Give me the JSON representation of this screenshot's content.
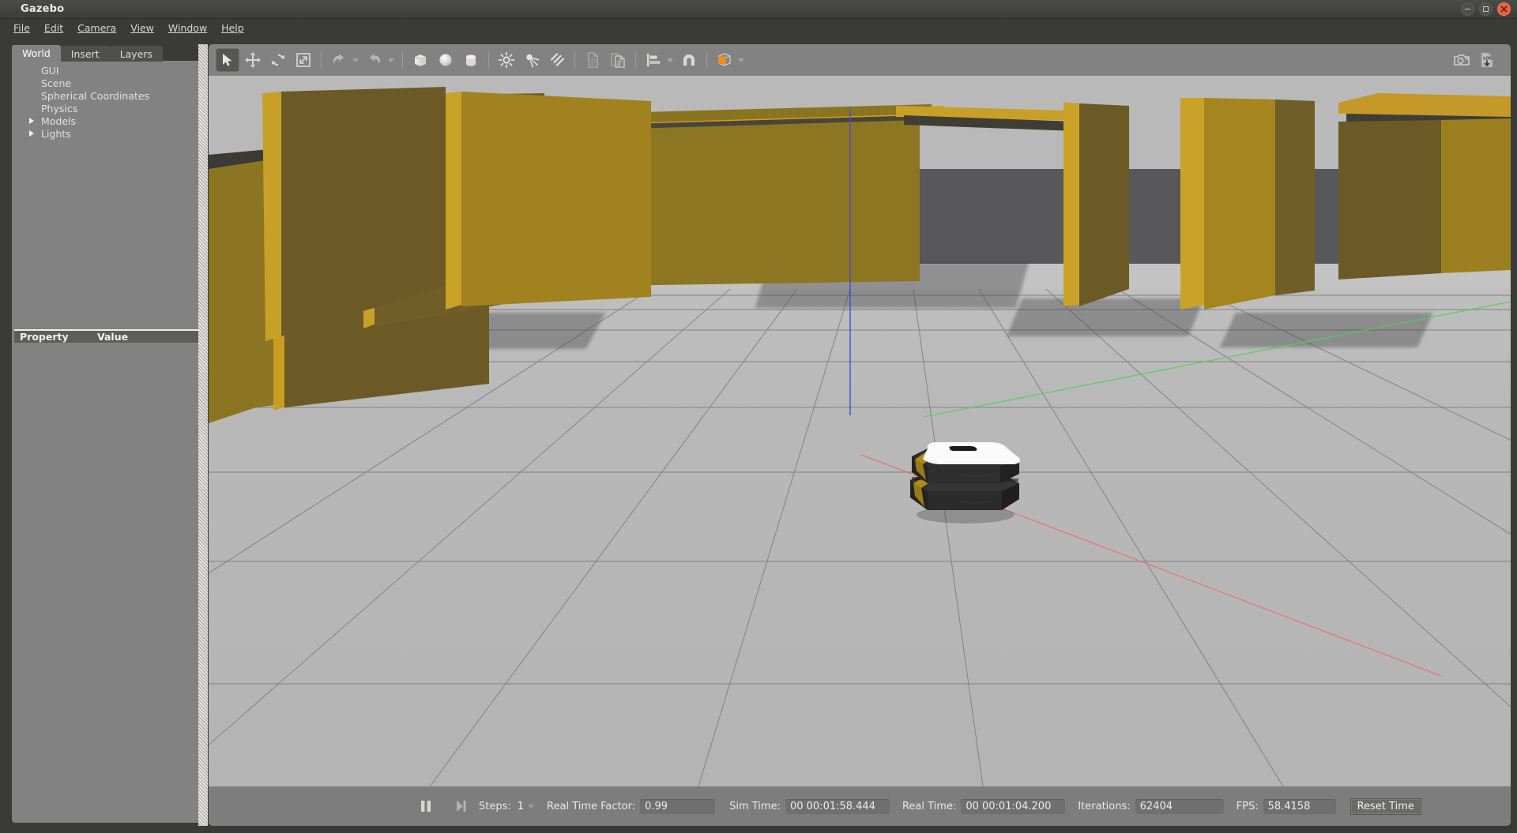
{
  "window": {
    "title": "Gazebo",
    "controls": [
      {
        "name": "minimize",
        "glyph": "–"
      },
      {
        "name": "maximize",
        "glyph": "□"
      },
      {
        "name": "close",
        "glyph": "×"
      }
    ]
  },
  "menubar": {
    "items": [
      {
        "label": "File",
        "mnemonic": "F"
      },
      {
        "label": "Edit",
        "mnemonic": "E"
      },
      {
        "label": "Camera",
        "mnemonic": "C"
      },
      {
        "label": "View",
        "mnemonic": "V"
      },
      {
        "label": "Window",
        "mnemonic": "W"
      },
      {
        "label": "Help",
        "mnemonic": "H"
      }
    ]
  },
  "left_panel": {
    "tabs": [
      {
        "label": "World",
        "active": true
      },
      {
        "label": "Insert",
        "active": false
      },
      {
        "label": "Layers",
        "active": false
      }
    ],
    "tree": [
      {
        "label": "GUI",
        "expandable": false
      },
      {
        "label": "Scene",
        "expandable": false
      },
      {
        "label": "Spherical Coordinates",
        "expandable": false
      },
      {
        "label": "Physics",
        "expandable": false
      },
      {
        "label": "Models",
        "expandable": true
      },
      {
        "label": "Lights",
        "expandable": true
      }
    ],
    "property_table": {
      "columns": [
        "Property",
        "Value"
      ],
      "rows": []
    }
  },
  "toolbar": {
    "groups": [
      {
        "name": "manipulation",
        "buttons": [
          {
            "name": "select-mode",
            "icon": "cursor-arrow-icon",
            "label": "Selection Mode",
            "active": true
          },
          {
            "name": "translate-mode",
            "icon": "move-arrows-icon",
            "label": "Translation Mode",
            "active": false
          },
          {
            "name": "rotate-mode",
            "icon": "rotate-arrows-icon",
            "label": "Rotation Mode",
            "active": false
          },
          {
            "name": "scale-mode",
            "icon": "scale-diagonal-icon",
            "label": "Scale Mode",
            "active": false
          }
        ]
      },
      {
        "name": "history",
        "buttons": [
          {
            "name": "undo",
            "icon": "undo-arrow-icon",
            "label": "Undo",
            "has_dropdown": true
          },
          {
            "name": "redo",
            "icon": "redo-arrow-icon",
            "label": "Redo",
            "has_dropdown": true
          }
        ]
      },
      {
        "name": "primitives",
        "buttons": [
          {
            "name": "insert-box",
            "icon": "box-icon",
            "label": "Box"
          },
          {
            "name": "insert-sphere",
            "icon": "sphere-icon",
            "label": "Sphere"
          },
          {
            "name": "insert-cylinder",
            "icon": "cylinder-icon",
            "label": "Cylinder"
          }
        ]
      },
      {
        "name": "lights",
        "buttons": [
          {
            "name": "insert-point-light",
            "icon": "point-light-icon",
            "label": "Point Light"
          },
          {
            "name": "insert-spot-light",
            "icon": "spot-light-icon",
            "label": "Spot Light"
          },
          {
            "name": "insert-directional-light",
            "icon": "directional-light-icon",
            "label": "Directional Light"
          }
        ]
      },
      {
        "name": "clipboard",
        "buttons": [
          {
            "name": "copy",
            "icon": "copy-icon",
            "label": "Copy"
          },
          {
            "name": "paste",
            "icon": "paste-icon",
            "label": "Paste"
          }
        ]
      },
      {
        "name": "align-snap",
        "buttons": [
          {
            "name": "align",
            "icon": "align-icon",
            "label": "Align",
            "has_dropdown": true
          },
          {
            "name": "snap",
            "icon": "magnet-snap-icon",
            "label": "Snap"
          }
        ]
      },
      {
        "name": "view-mode",
        "buttons": [
          {
            "name": "view-transparent",
            "icon": "orange-cube-icon",
            "label": "View",
            "has_dropdown": true
          }
        ]
      }
    ],
    "right_buttons": [
      {
        "name": "screenshot",
        "icon": "camera-icon",
        "label": "Take a screenshot"
      },
      {
        "name": "log-record",
        "icon": "log-download-icon",
        "label": "Log Data"
      }
    ]
  },
  "status_bar": {
    "play_pause": {
      "name": "pause-button",
      "icon": "pause-icon",
      "state": "pause"
    },
    "step": {
      "name": "step-button",
      "icon": "step-forward-icon"
    },
    "steps_label": "Steps:",
    "steps_value": "1",
    "fields": [
      {
        "name": "real-time-factor",
        "label": "Real Time Factor:",
        "value": "0.99",
        "width_class": "w-rtf"
      },
      {
        "name": "sim-time",
        "label": "Sim Time:",
        "value": "00 00:01:58.444",
        "width_class": "w-time"
      },
      {
        "name": "real-time",
        "label": "Real Time:",
        "value": "00 00:01:04.200",
        "width_class": "w-time"
      },
      {
        "name": "iterations",
        "label": "Iterations:",
        "value": "62404",
        "width_class": "w-iter"
      },
      {
        "name": "fps",
        "label": "FPS:",
        "value": "58.4158",
        "width_class": "w-fps"
      }
    ],
    "reset_button": "Reset Time"
  },
  "scene": {
    "description": "Gazebo 3D warehouse simulation viewport",
    "sky_color": "#b9b9b9",
    "far_wall_color": "#58585a",
    "floor_color": "#b6b6b6",
    "grid_line_color": "#6f6f6f",
    "shelf_color": "#a8861f",
    "shelf_shadow_color": "#6b5a26",
    "axes": [
      {
        "name": "x-axis",
        "color": "#f06a6a",
        "direction": "down-right"
      },
      {
        "name": "y-axis",
        "color": "#4fd24f",
        "direction": "up-right"
      },
      {
        "name": "z-axis",
        "color": "#5a5ad8",
        "direction": "vertical"
      }
    ],
    "robot": {
      "name": "warehouse-robot",
      "body_color": "#2e2e2e",
      "top_color": "#f5f5f5",
      "stripe_color": "#b08a1a"
    }
  }
}
